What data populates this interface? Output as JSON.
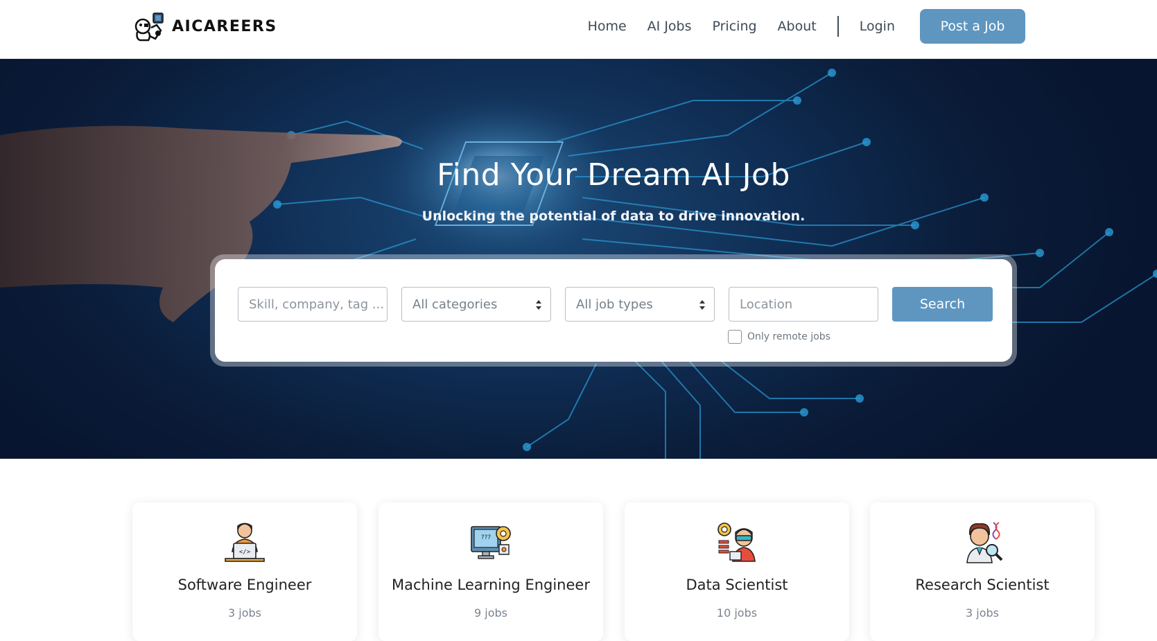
{
  "brand": {
    "name": "AICAREERS"
  },
  "nav": {
    "items": [
      "Home",
      "AI Jobs",
      "Pricing",
      "About"
    ],
    "login": "Login",
    "post_job": "Post a Job"
  },
  "hero": {
    "title": "Find Your Dream AI Job",
    "subtitle": "Unlocking the potential of data to drive innovation."
  },
  "search": {
    "keyword_placeholder": "Skill, company, tag ...",
    "category_value": "All categories",
    "job_type_value": "All job types",
    "location_placeholder": "Location",
    "button": "Search",
    "remote_label": "Only remote jobs",
    "remote_checked": false
  },
  "categories": [
    {
      "title": "Software Engineer",
      "count": "3 jobs",
      "icon": "software-engineer-icon"
    },
    {
      "title": "Machine Learning Engineer",
      "count": "9 jobs",
      "icon": "machine-learning-icon"
    },
    {
      "title": "Data Scientist",
      "count": "10 jobs",
      "icon": "data-scientist-icon"
    },
    {
      "title": "Research Scientist",
      "count": "3 jobs",
      "icon": "research-scientist-icon"
    }
  ],
  "colors": {
    "accent": "#5f96c0",
    "hero_dark": "#0a1c38",
    "hero_circuit": "#2a9bd6"
  }
}
